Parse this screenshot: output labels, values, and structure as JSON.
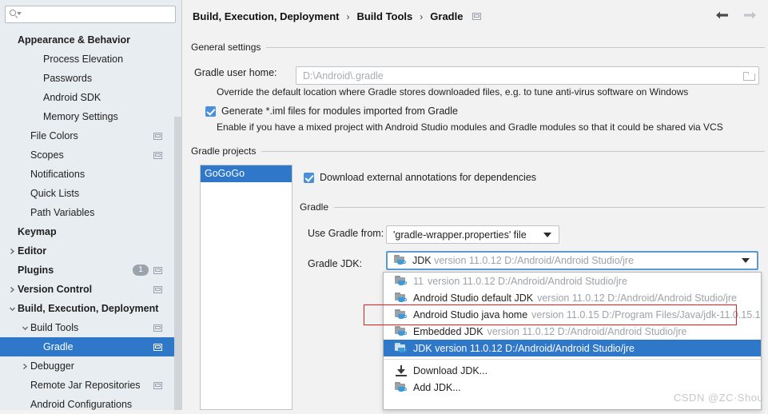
{
  "sidebar": {
    "search": {
      "value": "",
      "placeholder": "",
      "icon": "search-icon"
    },
    "items": [
      {
        "label": "Appearance & Behavior",
        "indent": 0,
        "bold": true,
        "arrow": "",
        "win": false,
        "badge": "",
        "selected": false
      },
      {
        "label": "Process Elevation",
        "indent": 2,
        "bold": false,
        "arrow": "",
        "win": false,
        "badge": "",
        "selected": false
      },
      {
        "label": "Passwords",
        "indent": 2,
        "bold": false,
        "arrow": "",
        "win": false,
        "badge": "",
        "selected": false
      },
      {
        "label": "Android SDK",
        "indent": 2,
        "bold": false,
        "arrow": "",
        "win": false,
        "badge": "",
        "selected": false
      },
      {
        "label": "Memory Settings",
        "indent": 2,
        "bold": false,
        "arrow": "",
        "win": false,
        "badge": "",
        "selected": false
      },
      {
        "label": "File Colors",
        "indent": 1,
        "bold": false,
        "arrow": "",
        "win": true,
        "badge": "",
        "selected": false
      },
      {
        "label": "Scopes",
        "indent": 1,
        "bold": false,
        "arrow": "",
        "win": true,
        "badge": "",
        "selected": false
      },
      {
        "label": "Notifications",
        "indent": 1,
        "bold": false,
        "arrow": "",
        "win": false,
        "badge": "",
        "selected": false
      },
      {
        "label": "Quick Lists",
        "indent": 1,
        "bold": false,
        "arrow": "",
        "win": false,
        "badge": "",
        "selected": false
      },
      {
        "label": "Path Variables",
        "indent": 1,
        "bold": false,
        "arrow": "",
        "win": false,
        "badge": "",
        "selected": false
      },
      {
        "label": "Keymap",
        "indent": 0,
        "bold": true,
        "arrow": "",
        "win": false,
        "badge": "",
        "selected": false
      },
      {
        "label": "Editor",
        "indent": 0,
        "bold": true,
        "arrow": "right",
        "win": false,
        "badge": "",
        "selected": false
      },
      {
        "label": "Plugins",
        "indent": 0,
        "bold": true,
        "arrow": "",
        "win": true,
        "badge": "1",
        "selected": false
      },
      {
        "label": "Version Control",
        "indent": 0,
        "bold": true,
        "arrow": "right",
        "win": true,
        "badge": "",
        "selected": false
      },
      {
        "label": "Build, Execution, Deployment",
        "indent": 0,
        "bold": true,
        "arrow": "down",
        "win": false,
        "badge": "",
        "selected": false
      },
      {
        "label": "Build Tools",
        "indent": 1,
        "bold": false,
        "arrow": "down",
        "win": true,
        "badge": "",
        "selected": false
      },
      {
        "label": "Gradle",
        "indent": 2,
        "bold": false,
        "arrow": "",
        "win": true,
        "badge": "",
        "selected": true
      },
      {
        "label": "Debugger",
        "indent": 1,
        "bold": false,
        "arrow": "right",
        "win": false,
        "badge": "",
        "selected": false
      },
      {
        "label": "Remote Jar Repositories",
        "indent": 1,
        "bold": false,
        "arrow": "",
        "win": true,
        "badge": "",
        "selected": false
      },
      {
        "label": "Android Configurations",
        "indent": 1,
        "bold": false,
        "arrow": "",
        "win": false,
        "badge": "",
        "selected": false
      }
    ]
  },
  "header": {
    "breadcrumb": [
      "Build, Execution, Deployment",
      "Build Tools",
      "Gradle"
    ],
    "separator": "›",
    "back_icon": "arrow-left-icon",
    "forward_icon": "arrow-right-icon"
  },
  "general_settings": {
    "title": "General settings",
    "gradle_user_home_label": "Gradle user home:",
    "gradle_user_home_placeholder": "D:\\Android\\.gradle",
    "gradle_user_home_value": "",
    "browse_icon": "folder-icon",
    "hint": "Override the default location where Gradle stores downloaded files, e.g. to tune anti-virus software on Windows",
    "generate_iml_label": "Generate *.iml files for modules imported from Gradle",
    "generate_iml_checked": true,
    "generate_iml_hint": "Enable if you have a mixed project with Android Studio modules and Gradle modules so that it could be shared via VCS"
  },
  "gradle_projects": {
    "title": "Gradle projects",
    "project_list": [
      "GoGoGo"
    ],
    "selected_project": "GoGoGo",
    "download_annotations_label": "Download external annotations for dependencies",
    "download_annotations_checked": true,
    "gradle_group_title": "Gradle",
    "use_gradle_from_label": "Use Gradle from:",
    "use_gradle_from_value": "'gradle-wrapper.properties' file",
    "gradle_jdk_label": "Gradle JDK:",
    "gradle_jdk_value_name": "JDK",
    "gradle_jdk_value_version": "version 11.0.12 D:/Android/Android Studio/jre"
  },
  "jdk_dropdown": {
    "items": [
      {
        "name": "11",
        "version": "version 11.0.12 D:/Android/Android Studio/jre",
        "icon": "jdk-icon",
        "selected": false,
        "dim": true
      },
      {
        "name": "Android Studio default JDK",
        "version": "version 11.0.12 D:/Android/Android Studio/jre",
        "icon": "jdk-icon",
        "selected": false,
        "dim": false
      },
      {
        "name": "Android Studio java home",
        "version": "version 11.0.15 D:/Program Files/Java/jdk-11.0.15.1",
        "icon": "jdk-icon",
        "selected": false,
        "dim": false
      },
      {
        "name": "Embedded JDK",
        "version": "version 11.0.12 D:/Android/Android Studio/jre",
        "icon": "jdk-icon",
        "selected": false,
        "dim": false
      },
      {
        "name": "JDK version 11.0.12 D:/Android/Android Studio/jre",
        "version": "",
        "icon": "jdk-icon",
        "selected": true,
        "dim": false
      }
    ],
    "actions": [
      {
        "name": "Download JDK...",
        "icon": "download-icon"
      },
      {
        "name": "Add JDK...",
        "icon": "jdk-icon"
      }
    ],
    "highlight_index": 2,
    "highlight_color": "#ee1c1c"
  },
  "watermark": {
    "text": "CSDN @ZC·Shou"
  },
  "colors": {
    "accent": "#2f77c9",
    "checkbox": "#4a90d9",
    "sidebar_bg": "#e8edf1",
    "panel_bg": "#f2f2f2",
    "highlight": "#ee1c1c"
  }
}
